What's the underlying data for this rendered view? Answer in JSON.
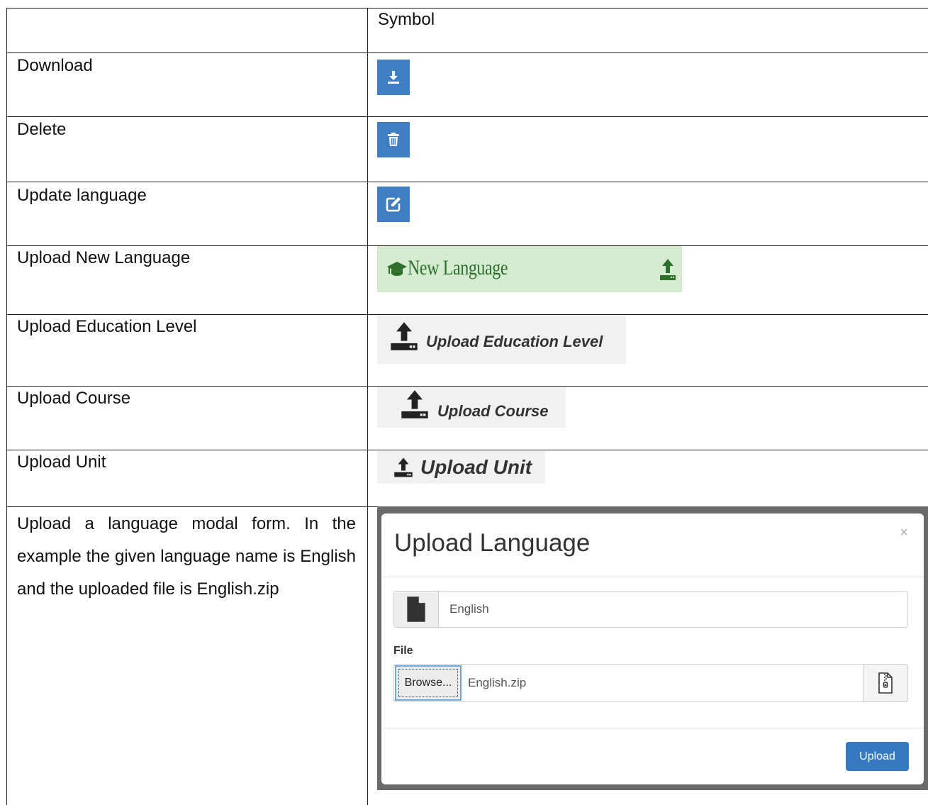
{
  "header": {
    "col1": "",
    "col2": "Symbol"
  },
  "rows": [
    {
      "label": "Download",
      "icon": "download-icon",
      "color": "#3f7ec2"
    },
    {
      "label": "Delete",
      "icon": "trash-icon",
      "color": "#3f7ec2"
    },
    {
      "label": "Update language",
      "icon": "edit-icon",
      "color": "#3f7ec2"
    },
    {
      "label": "Upload New Language",
      "button_text": "New Language",
      "icon": "graduation-cap-icon",
      "color": "#d5ecd1"
    },
    {
      "label": "Upload Education Level",
      "button_text": "Upload Education Level",
      "icon": "upload-icon"
    },
    {
      "label": "Upload Course",
      "button_text": "Upload Course",
      "icon": "upload-icon"
    },
    {
      "label": "Upload Unit",
      "button_text": "Upload Unit",
      "icon": "upload-icon"
    }
  ],
  "modal_row": {
    "label": "Upload a language modal form. In the example the given language name is English and the uploaded file is English.zip"
  },
  "modal": {
    "title": "Upload Language",
    "close": "×",
    "name_value": "English",
    "file_label": "File",
    "browse_label": "Browse...",
    "file_value": "English.zip",
    "submit_label": "Upload",
    "accent_color": "#3579c0"
  }
}
